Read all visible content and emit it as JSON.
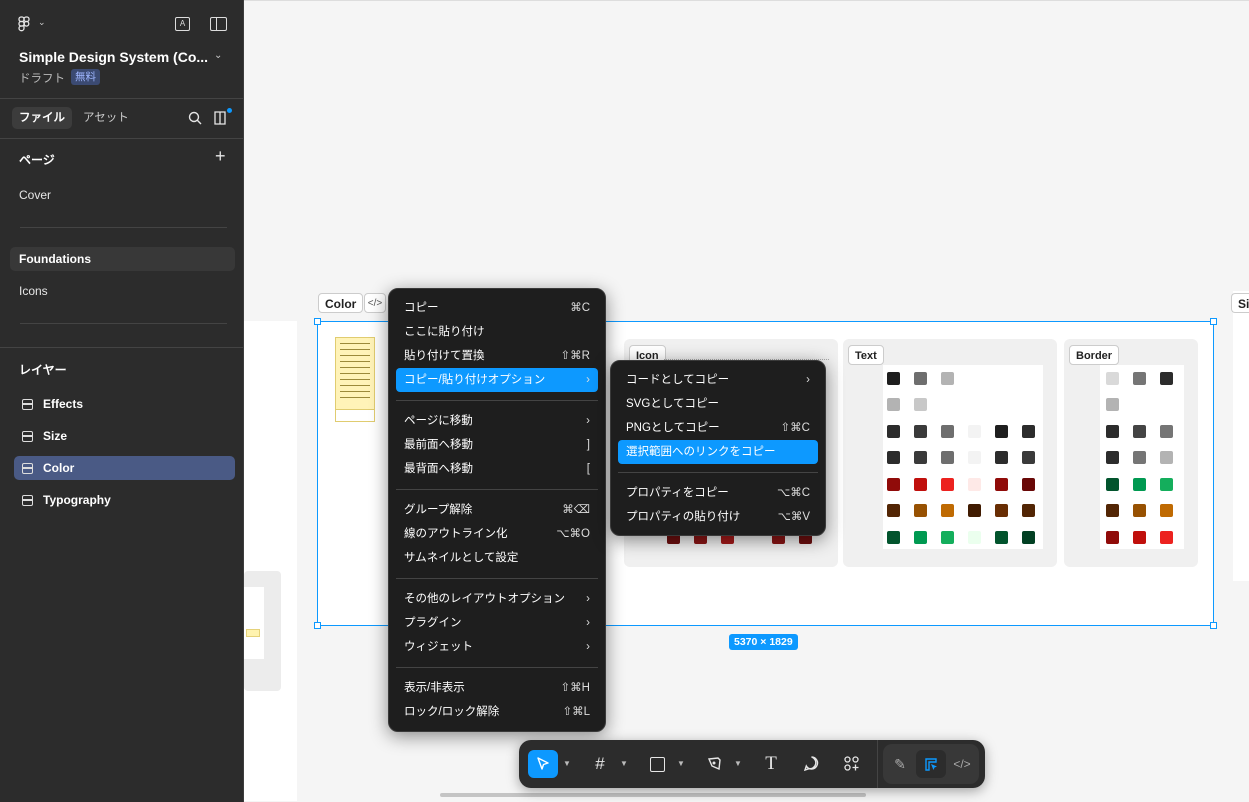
{
  "sidebar": {
    "file_name": "Simple Design System (Co...",
    "draft_label": "ドラフト",
    "plan_badge": "無料",
    "tabs": [
      {
        "label": "ファイル"
      },
      {
        "label": "アセット"
      }
    ],
    "pages_header": "ページ",
    "pages": [
      {
        "label": "Cover"
      },
      {
        "label": "Foundations"
      },
      {
        "label": "Icons"
      }
    ],
    "layers_header": "レイヤー",
    "layers": [
      {
        "label": "Effects"
      },
      {
        "label": "Size"
      },
      {
        "label": "Color"
      },
      {
        "label": "Typography"
      }
    ]
  },
  "canvas": {
    "frame_tag": "Color",
    "frame_size": "5370 × 1829",
    "right_tag": "Si",
    "cards": [
      {
        "title": "Icon"
      },
      {
        "title": "Text"
      },
      {
        "title": "Border"
      }
    ]
  },
  "context_menu": {
    "groups": [
      [
        {
          "label": "コピー",
          "shortcut": "⌘C"
        },
        {
          "label": "ここに貼り付け",
          "shortcut": ""
        },
        {
          "label": "貼り付けて置換",
          "shortcut": "⇧⌘R"
        },
        {
          "label": "コピー/貼り付けオプション",
          "shortcut": "›",
          "highlighted": true
        }
      ],
      [
        {
          "label": "ページに移動",
          "shortcut": "›"
        },
        {
          "label": "最前面へ移動",
          "shortcut": "]"
        },
        {
          "label": "最背面へ移動",
          "shortcut": "["
        }
      ],
      [
        {
          "label": "グループ解除",
          "shortcut": "⌘⌫"
        },
        {
          "label": "線のアウトライン化",
          "shortcut": "⌥⌘O"
        },
        {
          "label": "サムネイルとして設定",
          "shortcut": ""
        }
      ],
      [
        {
          "label": "その他のレイアウトオプション",
          "shortcut": "›"
        },
        {
          "label": "プラグイン",
          "shortcut": "›"
        },
        {
          "label": "ウィジェット",
          "shortcut": "›"
        }
      ],
      [
        {
          "label": "表示/非表示",
          "shortcut": "⇧⌘H"
        },
        {
          "label": "ロック/ロック解除",
          "shortcut": "⇧⌘L"
        }
      ]
    ]
  },
  "submenu": {
    "groups": [
      [
        {
          "label": "コードとしてコピー",
          "shortcut": "›"
        },
        {
          "label": "SVGとしてコピー",
          "shortcut": ""
        },
        {
          "label": "PNGとしてコピー",
          "shortcut": "⇧⌘C"
        },
        {
          "label": "選択範囲へのリンクをコピー",
          "shortcut": "",
          "highlighted": true
        }
      ],
      [
        {
          "label": "プロパティをコピー",
          "shortcut": "⌥⌘C"
        },
        {
          "label": "プロパティの貼り付け",
          "shortcut": "⌥⌘V"
        }
      ]
    ]
  },
  "toolbar": {
    "tools": [
      "move-tool",
      "frame-tool",
      "shape-tool",
      "pen-tool",
      "text-tool",
      "comment-tool",
      "actions-tool"
    ],
    "modes": [
      "draw-mode",
      "design-mode",
      "dev-mode"
    ]
  },
  "colors": {
    "accent": "#0d99ff",
    "sidebar_bg": "#2c2c2c",
    "menu_bg": "#1e1e1e",
    "selected_layer": "#4a5a85"
  }
}
